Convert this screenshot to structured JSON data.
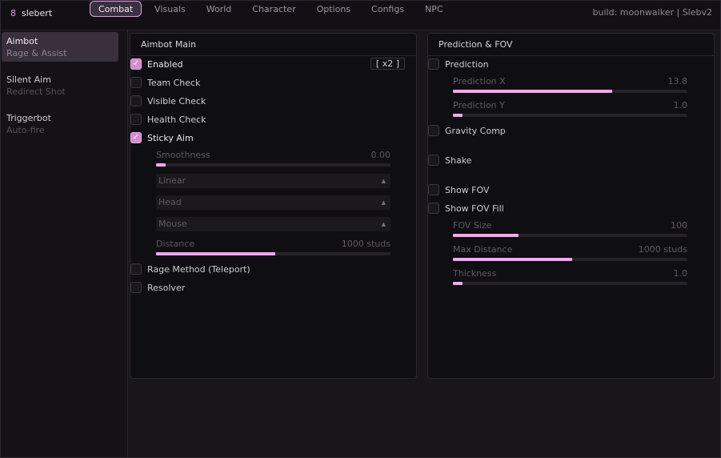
{
  "brand": {
    "icon": "8",
    "name": "slebert"
  },
  "tabs": [
    "Combat",
    "Visuals",
    "World",
    "Character",
    "Options",
    "Configs",
    "NPC"
  ],
  "build": "build: moonwalker | Slebv2",
  "sidebar": [
    {
      "title": "Aimbot",
      "subtitle": "Rage & Assist",
      "active": true
    },
    {
      "title": "Silent Aim",
      "subtitle": "Redirect Shot",
      "active": false
    },
    {
      "title": "Triggerbot",
      "subtitle": "Auto-fire",
      "active": false
    }
  ],
  "aimbot": {
    "title": "Aimbot Main",
    "keybind": "[ x2 ]",
    "enabled": {
      "label": "Enabled",
      "checked": true
    },
    "team_check": {
      "label": "Team Check",
      "checked": false
    },
    "visible_check": {
      "label": "Visible Check",
      "checked": false
    },
    "health_check": {
      "label": "Health Check",
      "checked": false
    },
    "sticky_aim": {
      "label": "Sticky Aim",
      "checked": true
    },
    "smoothness": {
      "label": "Smoothness",
      "value": "0.00",
      "fraction": 0.04
    },
    "dropdown_easing": "Linear",
    "dropdown_bone": "Head",
    "dropdown_method": "Mouse",
    "distance": {
      "label": "Distance",
      "value": "1000 studs",
      "fraction": 0.51
    },
    "rage_method": {
      "label": "Rage Method (Teleport)",
      "checked": false
    },
    "resolver": {
      "label": "Resolver",
      "checked": false
    }
  },
  "prediction": {
    "title": "Prediction & FOV",
    "prediction": {
      "label": "Prediction",
      "checked": false
    },
    "prediction_x": {
      "label": "Prediction X",
      "value": "13.8",
      "fraction": 0.68
    },
    "prediction_y": {
      "label": "Prediction Y",
      "value": "1.0",
      "fraction": 0.04
    },
    "gravity_comp": {
      "label": "Gravity Comp",
      "checked": false
    },
    "shake": {
      "label": "Shake",
      "checked": false
    },
    "show_fov": {
      "label": "Show FOV",
      "checked": false
    },
    "show_fov_fill": {
      "label": "Show FOV Fill",
      "checked": false
    },
    "fov_size": {
      "label": "FOV Size",
      "value": "100",
      "fraction": 0.28
    },
    "max_distance": {
      "label": "Max Distance",
      "value": "1000 studs",
      "fraction": 0.51
    },
    "thickness": {
      "label": "Thickness",
      "value": "1.0",
      "fraction": 0.04
    }
  },
  "colors": {
    "accent": "#f4a6ee",
    "background": "#161418",
    "panel": "#0f0e12"
  }
}
